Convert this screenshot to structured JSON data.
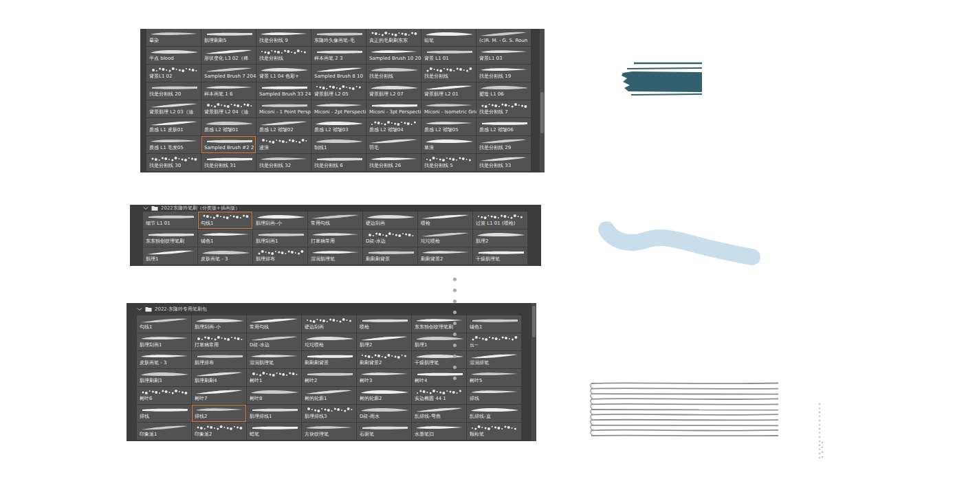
{
  "panels": [
    {
      "items": [
        {
          "label": "晕染",
          "selected": false
        },
        {
          "label": "肌理刷刷5",
          "selected": false
        },
        {
          "label": "找是分割线 9",
          "selected": false
        },
        {
          "label": "东隆吟头像画笔-毛",
          "selected": false
        },
        {
          "label": "真正的毛刷刷东东",
          "selected": false
        },
        {
          "label": "铅笔",
          "selected": false
        },
        {
          "label": "(c)R. M. - G. S. Roun",
          "selected": false
        },
        {
          "label": "平点 blood",
          "selected": false
        },
        {
          "label": "形状变化 L3 02（稀",
          "selected": false
        },
        {
          "label": "找是分割线",
          "selected": false
        },
        {
          "label": "样本画笔 2 3",
          "selected": false
        },
        {
          "label": "Sampled Brush 10 20",
          "selected": false
        },
        {
          "label": "背景 L1 01",
          "selected": false
        },
        {
          "label": "背景L1 03",
          "selected": false
        },
        {
          "label": "背景L1 02",
          "selected": false
        },
        {
          "label": "Sampled Brush 7 2043",
          "selected": false
        },
        {
          "label": "背景 L1 04 色彩+",
          "selected": false
        },
        {
          "label": "Sampled Brush 8 10",
          "selected": false
        },
        {
          "label": "找是分割线",
          "selected": false
        },
        {
          "label": "找是分割线",
          "selected": false
        },
        {
          "label": "找是分割线 19",
          "selected": false
        },
        {
          "label": "找是分割线 20",
          "selected": false
        },
        {
          "label": "样本画笔 1 6",
          "selected": false
        },
        {
          "label": "Sampled Brush 33 24",
          "selected": false
        },
        {
          "label": "背景肌理 L2 05",
          "selected": false
        },
        {
          "label": "背景肌理 L2 07",
          "selected": false
        },
        {
          "label": "背景肌理 L2 01",
          "selected": false
        },
        {
          "label": "塑造 L1 06",
          "selected": false
        },
        {
          "label": "背景肌理 L2 03（油",
          "selected": false
        },
        {
          "label": "背景肌理 L2 04（油",
          "selected": false
        },
        {
          "label": "Miconi - 1 Point Persp",
          "selected": false
        },
        {
          "label": "Miconi - 2pt Perspecti",
          "selected": false
        },
        {
          "label": "Miconi - 3pt Perspecti",
          "selected": false
        },
        {
          "label": "Miconi - Isometric Grid",
          "selected": false
        },
        {
          "label": "找是分割线 7",
          "selected": false
        },
        {
          "label": "质感 L1 皮肤01",
          "selected": false
        },
        {
          "label": "质感 L2 褶皱01",
          "selected": false
        },
        {
          "label": "质感 L2 褶皱02",
          "selected": false
        },
        {
          "label": "质感 L2 褶皱03",
          "selected": false
        },
        {
          "label": "质感 L2 褶皱04",
          "selected": false
        },
        {
          "label": "质感 L2 褶皱05",
          "selected": false
        },
        {
          "label": "质感 L2 褶皱06",
          "selected": false
        },
        {
          "label": "质感 L1 毛发05",
          "selected": false
        },
        {
          "label": "Sampled Brush #2 2",
          "selected": true
        },
        {
          "label": "波浪",
          "selected": false
        },
        {
          "label": "制线1",
          "selected": false
        },
        {
          "label": "羽毛",
          "selected": false
        },
        {
          "label": "草浪",
          "selected": false
        },
        {
          "label": "找是分割线 29",
          "selected": false
        },
        {
          "label": "找是分割线 30",
          "selected": false
        },
        {
          "label": "找是分割线 31",
          "selected": false
        },
        {
          "label": "找是分割线 32",
          "selected": false
        },
        {
          "label": "找是分割线 6",
          "selected": false
        },
        {
          "label": "找是分割线 26",
          "selected": false
        },
        {
          "label": "找是分割线 5",
          "selected": false
        },
        {
          "label": "找是分割线 33",
          "selected": false
        }
      ]
    },
    {
      "header": "2022东隆吟笔刷（分类版+插画版）",
      "items": [
        {
          "label": "细节 L1 01",
          "selected": false
        },
        {
          "label": "勾线1",
          "selected": true
        },
        {
          "label": "肌理刮画-小",
          "selected": false
        },
        {
          "label": "常用勾线",
          "selected": false
        },
        {
          "label": "硬边刮画",
          "selected": false
        },
        {
          "label": "喷枪",
          "selected": false
        },
        {
          "label": "过渡 L1 01 (喷枪)",
          "selected": false
        },
        {
          "label": "东东独创纹理笔刷",
          "selected": false
        },
        {
          "label": "铺色1",
          "selected": false
        },
        {
          "label": "肌理刮画1",
          "selected": false
        },
        {
          "label": "打草稿常用",
          "selected": false
        },
        {
          "label": "D叔-水边",
          "selected": false
        },
        {
          "label": "坨坨喷枪",
          "selected": false
        },
        {
          "label": "肌理2",
          "selected": false
        },
        {
          "label": "肌理1",
          "selected": false
        },
        {
          "label": "皮肤画笔 - 3",
          "selected": false
        },
        {
          "label": "肌理排布",
          "selected": false
        },
        {
          "label": "湿润肌理笔",
          "selected": false
        },
        {
          "label": "刷刷刷背景",
          "selected": false
        },
        {
          "label": "刷刷背景2",
          "selected": false
        },
        {
          "label": "干燥肌理笔",
          "selected": false
        }
      ]
    },
    {
      "header": "2022-东隆吟专用笔刷包",
      "items": [
        {
          "label": "勾线1",
          "selected": false
        },
        {
          "label": "肌理刮画-小",
          "selected": false
        },
        {
          "label": "常用勾线",
          "selected": false
        },
        {
          "label": "硬边刮画",
          "selected": false
        },
        {
          "label": "喷枪",
          "selected": false
        },
        {
          "label": "东东独创纹理笔刷",
          "selected": false
        },
        {
          "label": "铺色1",
          "selected": false
        },
        {
          "label": "肌理刮画1",
          "selected": false
        },
        {
          "label": "打草稿常用",
          "selected": false
        },
        {
          "label": "D叔-水边",
          "selected": false
        },
        {
          "label": "坨坨喷枪",
          "selected": false
        },
        {
          "label": "肌理2",
          "selected": false
        },
        {
          "label": "肌理1",
          "selected": false
        },
        {
          "label": "云~",
          "selected": false
        },
        {
          "label": "皮肤画笔 - 3",
          "selected": false
        },
        {
          "label": "肌理排布",
          "selected": false
        },
        {
          "label": "湿润肌理笔",
          "selected": false
        },
        {
          "label": "刷刷刷背景",
          "selected": false
        },
        {
          "label": "刷刷背景2",
          "selected": false
        },
        {
          "label": "干燥肌理笔",
          "selected": false
        },
        {
          "label": "湿润排笔",
          "selected": false
        },
        {
          "label": "肌理刷刷3",
          "selected": false
        },
        {
          "label": "肌理刷刷4",
          "selected": false
        },
        {
          "label": "树叶1",
          "selected": false
        },
        {
          "label": "树叶2",
          "selected": false
        },
        {
          "label": "树叶3",
          "selected": false
        },
        {
          "label": "树叶4",
          "selected": false
        },
        {
          "label": "树叶5",
          "selected": false
        },
        {
          "label": "树叶6",
          "selected": false
        },
        {
          "label": "树叶7",
          "selected": false
        },
        {
          "label": "树叶8",
          "selected": false
        },
        {
          "label": "树的轮廓1",
          "selected": false
        },
        {
          "label": "树的轮廓2",
          "selected": false
        },
        {
          "label": "实边椭圆 44 1",
          "selected": false
        },
        {
          "label": "排线",
          "selected": false
        },
        {
          "label": "排线",
          "selected": false
        },
        {
          "label": "排线2",
          "selected": true
        },
        {
          "label": "肌理排线1",
          "selected": false
        },
        {
          "label": "肌理排线3",
          "selected": false
        },
        {
          "label": "D叔-雨水",
          "selected": false
        },
        {
          "label": "乱排线-弯曲",
          "selected": false
        },
        {
          "label": "乱排线-直",
          "selected": false
        },
        {
          "label": "印象派1",
          "selected": false
        },
        {
          "label": "印象派2",
          "selected": false
        },
        {
          "label": "蜡笔",
          "selected": false
        },
        {
          "label": "方块纹理笔",
          "selected": false
        },
        {
          "label": "石斑笔",
          "selected": false
        },
        {
          "label": "水墨笔扫",
          "selected": false
        },
        {
          "label": "颗粒笔",
          "selected": false
        }
      ]
    }
  ],
  "strokes": [
    {
      "kind": "lines",
      "color": "#33606f"
    },
    {
      "kind": "wave",
      "color": "#c8deeb"
    },
    {
      "kind": "stack",
      "color": "#8e8e8e"
    }
  ]
}
